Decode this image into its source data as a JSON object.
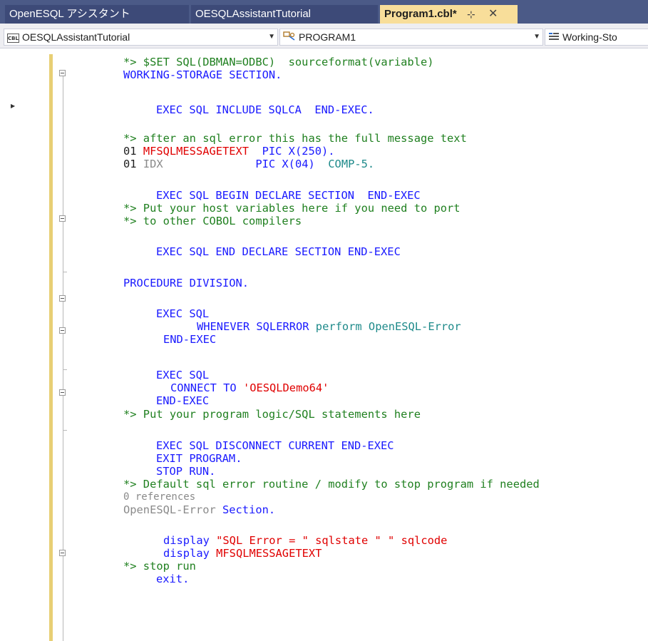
{
  "tabs": [
    {
      "label": "OpenESQL アシスタント"
    },
    {
      "label": "OESQLAssistantTutorial"
    },
    {
      "label": "Program1.cbl*",
      "pin": "⊹",
      "close": "✕"
    }
  ],
  "navbar": {
    "project": "OESQLAssistantTutorial",
    "program": "PROGRAM1",
    "section": "Working-Sto"
  },
  "code": {
    "l1": "*> $SET SQL(DBMAN=ODBC)  sourceformat(variable)",
    "l2": "WORKING-STORAGE SECTION.",
    "l4": "EXEC SQL INCLUDE SQLCA  END-EXEC.",
    "l6": "*> after an sql error this has the full message text",
    "l7a": "01 ",
    "l7b": "MFSQLMESSAGETEXT",
    "l7c": "  PIC X(250).",
    "l8a": "01 ",
    "l8b": "IDX",
    "l8c": "              PIC X(04)  ",
    "l8d": "COMP-5.",
    "l10": "EXEC SQL BEGIN DECLARE SECTION  END-EXEC",
    "l11": "*> Put your host variables here if you need to port",
    "l12": "*> to other COBOL compilers",
    "l14": "EXEC SQL END DECLARE SECTION END-EXEC",
    "l16": "PROCEDURE DIVISION.",
    "l18": "EXEC SQL",
    "l19a": "WHENEVER SQLERROR ",
    "l19b": "perform OpenESQL-Error",
    "l20": "END-EXEC",
    "l22": "EXEC SQL",
    "l23a": "CONNECT TO ",
    "l23b": "'OESQLDemo64'",
    "l24": "END-EXEC",
    "l25": "*> Put your program logic/SQL statements here",
    "l27": "EXEC SQL DISCONNECT CURRENT END-EXEC",
    "l28": "EXIT PROGRAM.",
    "l29": "STOP RUN.",
    "l30": "*> Default sql error routine / modify to stop program if needed",
    "refs": "0 references",
    "l31a": "OpenESQL-Error ",
    "l31b": "Section.",
    "l33a": "display ",
    "l33b": "\"SQL Error = \" sqlstate \" \" sqlcode",
    "l34a": "display ",
    "l34b": "MFSQLMESSAGETEXT",
    "l35": "*> stop run",
    "l36": "exit."
  },
  "colors": {
    "tab_bar": "#4b5a87",
    "active_tab": "#f8de9a",
    "comment": "#208020",
    "keyword": "#1a1aff",
    "identifier_red": "#e00000",
    "paragraph_teal": "#1e8a8a"
  }
}
